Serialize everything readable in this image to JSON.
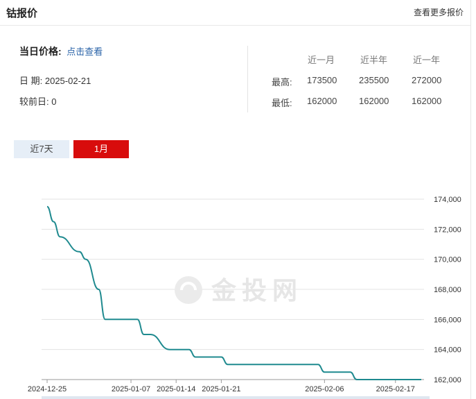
{
  "header": {
    "title": "钴报价",
    "more_link": "查看更多报价"
  },
  "today": {
    "label": "当日价格:",
    "link": "点击查看",
    "date_label": "日 期:",
    "date": "2025-02-21",
    "change_label": "较前日:",
    "change": "0"
  },
  "stats": {
    "columns": [
      "近一月",
      "近半年",
      "近一年"
    ],
    "rows": [
      {
        "label": "最高:",
        "values": [
          "173500",
          "235500",
          "272000"
        ]
      },
      {
        "label": "最低:",
        "values": [
          "162000",
          "162000",
          "162000"
        ]
      }
    ]
  },
  "range_tabs": [
    {
      "label": "近7天",
      "active": false
    },
    {
      "label": "1月",
      "active": true
    }
  ],
  "watermark": {
    "text": "金投网",
    "icon": "jintou-logo-icon"
  },
  "colors": {
    "line": "#1f8a8f",
    "active_tab": "#d80c0c",
    "inactive_tab": "#e6eef7",
    "link": "#2a63a8"
  },
  "chart_data": {
    "type": "line",
    "x_tick_labels": [
      "2024-12-25",
      "2025-01-07",
      "2025-01-14",
      "2025-01-21",
      "2025-02-06",
      "2025-02-17"
    ],
    "y_tick_labels": [
      "174,000",
      "172,000",
      "170,000",
      "168,000",
      "166,000",
      "164,000",
      "162,000"
    ],
    "ylim": [
      162000,
      174000
    ],
    "y_axis_position": "right",
    "grid": "horizontal",
    "series": [
      {
        "x": [
          "2024-12-25",
          "2024-12-26",
          "2024-12-27",
          "2024-12-30",
          "2024-12-31",
          "2025-01-02",
          "2025-01-03",
          "2025-01-06",
          "2025-01-07",
          "2025-01-08",
          "2025-01-09",
          "2025-01-10",
          "2025-01-13",
          "2025-01-14",
          "2025-01-15",
          "2025-01-16",
          "2025-01-17",
          "2025-01-20",
          "2025-01-21",
          "2025-01-22",
          "2025-01-23",
          "2025-01-24",
          "2025-01-27",
          "2025-02-05",
          "2025-02-06",
          "2025-02-07",
          "2025-02-10",
          "2025-02-11",
          "2025-02-12",
          "2025-02-13",
          "2025-02-14",
          "2025-02-17",
          "2025-02-18",
          "2025-02-19",
          "2025-02-20",
          "2025-02-21"
        ],
        "values": [
          173500,
          172500,
          171500,
          170500,
          170000,
          168000,
          166000,
          166000,
          166000,
          166000,
          165000,
          165000,
          164000,
          164000,
          164000,
          164000,
          163500,
          163500,
          163500,
          163000,
          163000,
          163000,
          163000,
          163000,
          162500,
          162500,
          162500,
          162000,
          162000,
          162000,
          162000,
          162000,
          162000,
          162000,
          162000,
          162000
        ]
      }
    ]
  }
}
